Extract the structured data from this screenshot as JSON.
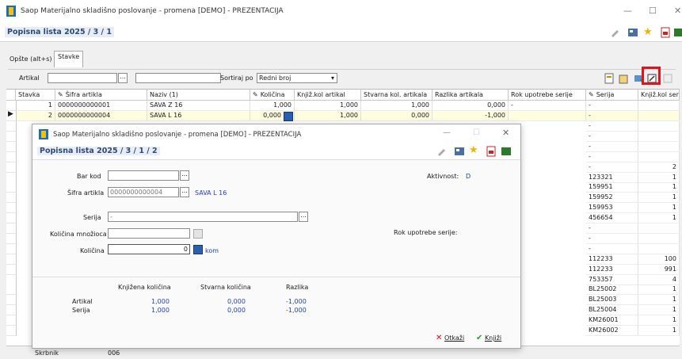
{
  "window": {
    "title": "Saop Materijalno skladišno poslovanje - promena [DEMO] - PREZENTACIJA",
    "doc_title": "Popisna lista 2025 / 3 / 1"
  },
  "tabs": [
    {
      "label": "Opšte (alt+s)"
    },
    {
      "label": "Stavke"
    }
  ],
  "filter": {
    "artikal_label": "Artikal",
    "sort_label": "Sortiraj po",
    "sort_value": "Redni broj"
  },
  "grid": {
    "columns": [
      "Stavka",
      "Šifra artikla",
      "Naziv (1)",
      "Količina",
      "Knjiž.kol artikal",
      "Stvarna kol. artikala",
      "Razlika artikala",
      "Rok upotrebe serije",
      "Serija",
      "Knjiž.kol seri"
    ],
    "rows": [
      {
        "stavka": "1",
        "sifra": "0000000000001",
        "naziv": "SAVA Z 16",
        "kolicina": "1,000",
        "knjiz": "1,000",
        "stvarna": "1,000",
        "razlika": "0,000",
        "rok": "-",
        "serija": "-",
        "knjiz_ser": ""
      },
      {
        "stavka": "2",
        "sifra": "0000000000004",
        "naziv": "SAVA L 16",
        "kolicina": "0,000",
        "knjiz": "1,000",
        "stvarna": "0,000",
        "razlika": "-1,000",
        "rok": "",
        "serija": "-",
        "knjiz_ser": ""
      }
    ],
    "right_rows": [
      {
        "serija": "-",
        "knjiz_ser": ""
      },
      {
        "serija": "-",
        "knjiz_ser": ""
      },
      {
        "serija": "-",
        "knjiz_ser": ""
      },
      {
        "serija": "-",
        "knjiz_ser": ""
      },
      {
        "serija": "-",
        "knjiz_ser": "2"
      },
      {
        "serija": "123321",
        "knjiz_ser": "1"
      },
      {
        "serija": "159951",
        "knjiz_ser": "1"
      },
      {
        "serija": "159952",
        "knjiz_ser": "1"
      },
      {
        "serija": "159953",
        "knjiz_ser": "1"
      },
      {
        "serija": "456654",
        "knjiz_ser": "1"
      },
      {
        "serija": "-",
        "knjiz_ser": ""
      },
      {
        "serija": "-",
        "knjiz_ser": ""
      },
      {
        "serija": "-",
        "knjiz_ser": ""
      },
      {
        "serija": "112233",
        "knjiz_ser": "100"
      },
      {
        "serija": "112233",
        "knjiz_ser": "991"
      },
      {
        "serija": "753357",
        "knjiz_ser": "4"
      },
      {
        "serija": "BL25002",
        "knjiz_ser": "1"
      },
      {
        "serija": "BL25003",
        "knjiz_ser": "1"
      },
      {
        "serija": "BL25004",
        "knjiz_ser": "1"
      },
      {
        "serija": "KM26001",
        "knjiz_ser": "1"
      },
      {
        "serija": "KM26002",
        "knjiz_ser": "1"
      }
    ]
  },
  "dialog": {
    "title": "Saop Materijalno skladišno poslovanje - promena [DEMO] - PREZENTACIJA",
    "doc_title": "Popisna lista 2025 / 3 / 1 / 2",
    "bar_kod_label": "Bar kod",
    "bar_kod_value": "",
    "sifra_label": "Šifra artikla",
    "sifra_value": "0000000000004",
    "sifra_name": "SAVA L 16",
    "aktivnost_label": "Aktivnost:",
    "aktivnost_value": "D",
    "serija_label": "Serija",
    "serija_value": "-",
    "rok_label": "Rok upotrebe serije:",
    "kol_mnoz_label": "Količina množioca",
    "kolicina_label": "Količina",
    "kolicina_value": "0",
    "unit": "kom",
    "summary": {
      "h_knjizena": "Knjižena količina",
      "h_stvarna": "Stvarna količina",
      "h_razlika": "Razlika",
      "artikal_label": "Artikal",
      "artikal_knjizena": "1,000",
      "artikal_stvarna": "0,000",
      "artikal_razlika": "-1,000",
      "serija_label": "Serija",
      "serija_knjizena": "1,000",
      "serija_stvarna": "0,000",
      "serija_razlika": "-1,000"
    },
    "cancel_label": "Otkaži",
    "ok_label": "Knjiži"
  },
  "footer": {
    "skrbnik_label": "Skrbnik",
    "skrbnik_value": "006"
  },
  "colors": {
    "accent_blue": "#1f3fb8",
    "highlight_row": "#fffde0",
    "red_highlight": "#e0141b"
  }
}
